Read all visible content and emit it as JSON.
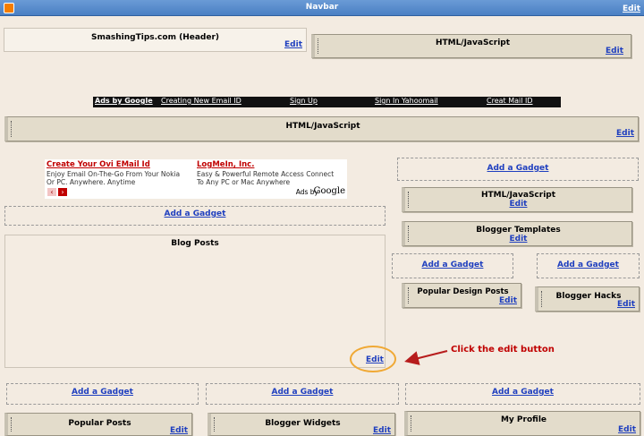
{
  "navbar": {
    "title": "Navbar",
    "edit": "Edit"
  },
  "header": {
    "title": "SmashingTips.com (Header)",
    "edit": "Edit"
  },
  "top_right_widget": {
    "title": "HTML/JavaScript",
    "edit": "Edit"
  },
  "ads_bar": {
    "brand": "Ads by Google",
    "links": [
      "Creating New Email ID",
      "Sign Up",
      "Sign In Yahoomail",
      "Creat Mail ID"
    ]
  },
  "wide_widget": {
    "title": "HTML/JavaScript",
    "edit": "Edit"
  },
  "ad_block": {
    "ad1_title": "Create Your Ovi EMail Id",
    "ad1_line1": "Enjoy Email On-The-Go From Your Nokia",
    "ad1_line2": "Or PC. Anywhere. Anytime",
    "ad2_title": "LogMeIn, Inc.",
    "ad2_line1": "Easy & Powerful Remote Access Connect",
    "ad2_line2": "To Any PC or Mac Anywhere",
    "ads_by": "Ads by",
    "google": "Google",
    "prev": "‹",
    "next": "›"
  },
  "main_add_gadget": "Add a Gadget",
  "blog_posts": {
    "title": "Blog Posts",
    "edit": "Edit"
  },
  "annotation": {
    "text": "Click the edit button"
  },
  "sidebar": {
    "add_gadget_top": "Add a Gadget",
    "html_js": {
      "title": "HTML/JavaScript",
      "edit": "Edit"
    },
    "templates": {
      "title": "Blogger Templates",
      "edit": "Edit"
    },
    "add_gadget_left": "Add a Gadget",
    "add_gadget_right": "Add a Gadget",
    "popular_design": {
      "title": "Popular Design Posts",
      "edit": "Edit"
    },
    "hacks": {
      "title": "Blogger Hacks",
      "edit": "Edit"
    }
  },
  "footer": {
    "add_gadget_1": "Add a Gadget",
    "add_gadget_2": "Add a Gadget",
    "add_gadget_3": "Add a Gadget",
    "popular_posts": {
      "title": "Popular Posts",
      "edit": "Edit"
    },
    "blogger_widgets": {
      "title": "Blogger Widgets",
      "edit": "Edit"
    },
    "my_profile": {
      "title": "My Profile",
      "edit": "Edit"
    }
  }
}
